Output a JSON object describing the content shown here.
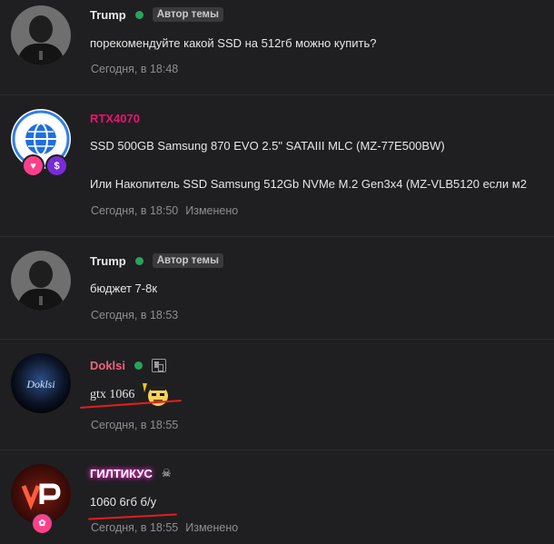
{
  "posts": [
    {
      "username": "Trump",
      "username_color": "#e8e8e8",
      "online": true,
      "badge": "Автор темы",
      "message": "порекомендуйте какой SSD на 512гб можно купить?",
      "time": "Сегодня, в 18:48"
    },
    {
      "username": "RTX4070",
      "username_color": "#e8156e",
      "message_line1": "SSD 500GB Samsung 870 EVO 2.5\" SATAIII MLC (MZ-77E500BW)",
      "message_line2": "Или Накопитель SSD Samsung 512Gb NVMe M.2 Gen3x4 (MZ-VLB5120 если м2",
      "time": "Сегодня, в 18:50",
      "edited": "Изменено"
    },
    {
      "username": "Trump",
      "username_color": "#e8e8e8",
      "online": true,
      "badge": "Автор темы",
      "message": "бюджет 7-8к",
      "time": "Сегодня, в 18:53"
    },
    {
      "username": "Doklsi",
      "username_color": "#f0637e",
      "online": true,
      "avatar_text": "Doklsi",
      "message": "gtx 1066",
      "time": "Сегодня, в 18:55"
    },
    {
      "username": "ГИЛТИКУС",
      "username_color": "#ffffff",
      "username_glow": "#ff2fd0",
      "message": "1060 6гб б/у",
      "time": "Сегодня, в 18:55",
      "edited": "Изменено"
    }
  ]
}
